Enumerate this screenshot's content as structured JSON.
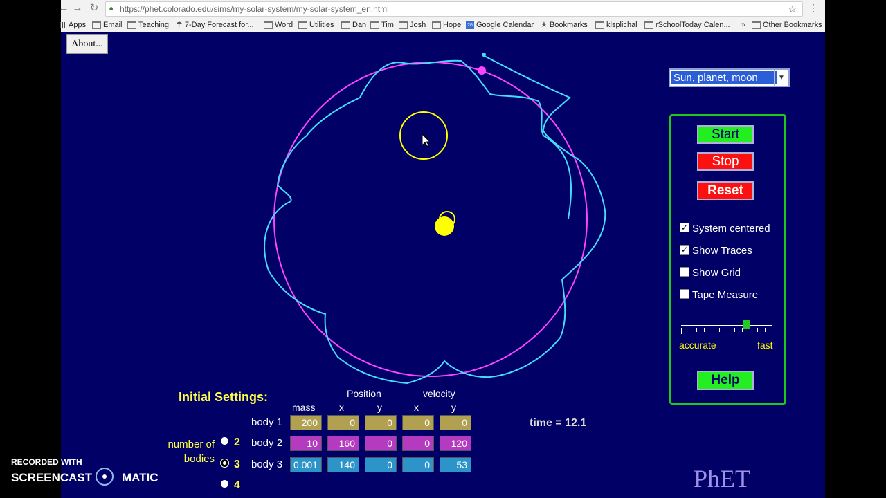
{
  "browser": {
    "url": "https://phet.colorado.edu/sims/my-solar-system/my-solar-system_en.html",
    "bookmarks": [
      "Apps",
      "Email",
      "Teaching",
      "7-Day Forecast for...",
      "Word",
      "Utilities",
      "Dan",
      "Tim",
      "Josh",
      "Hope",
      "Google Calendar",
      "Bookmarks",
      "klsplichal",
      "rSchoolToday Calen...",
      "Other Bookmarks"
    ],
    "cal_icon_text": "26",
    "overflow": "»"
  },
  "sim": {
    "about_label": "About...",
    "preset": "Sun, planet, moon",
    "buttons": {
      "start": "Start",
      "stop": "Stop",
      "reset": "Reset",
      "help": "Help"
    },
    "checkboxes": [
      {
        "label": "System centered",
        "checked": true
      },
      {
        "label": "Show Traces",
        "checked": true
      },
      {
        "label": "Show Grid",
        "checked": false
      },
      {
        "label": "Tape Measure",
        "checked": false
      }
    ],
    "speed": {
      "left_label": "accurate",
      "right_label": "fast",
      "value": 0.7
    },
    "initial_settings": {
      "title": "Initial Settings:",
      "group_position": "Position",
      "group_velocity": "velocity",
      "columns": [
        "mass",
        "x",
        "y",
        "x",
        "y"
      ],
      "rows": [
        {
          "label": "body 1",
          "values": [
            "200",
            "0",
            "0",
            "0",
            "0"
          ]
        },
        {
          "label": "body 2",
          "values": [
            "10",
            "160",
            "0",
            "0",
            "120"
          ]
        },
        {
          "label": "body 3",
          "values": [
            "0.001",
            "140",
            "0",
            "0",
            "53"
          ]
        }
      ]
    },
    "number_of_bodies": {
      "label": "number of bodies",
      "options": [
        "2",
        "3",
        "4"
      ],
      "selected": "3"
    },
    "time_text": "time = 12.1",
    "logo": "PhET",
    "colors": {
      "sun": "#ffff00",
      "planet": "#ff44ff",
      "moon": "#44ddff",
      "background": "#000066"
    }
  },
  "overlay": {
    "recorded_with": "RECORDED WITH",
    "brand_left": "SCREENCAST",
    "brand_right": "MATIC"
  }
}
